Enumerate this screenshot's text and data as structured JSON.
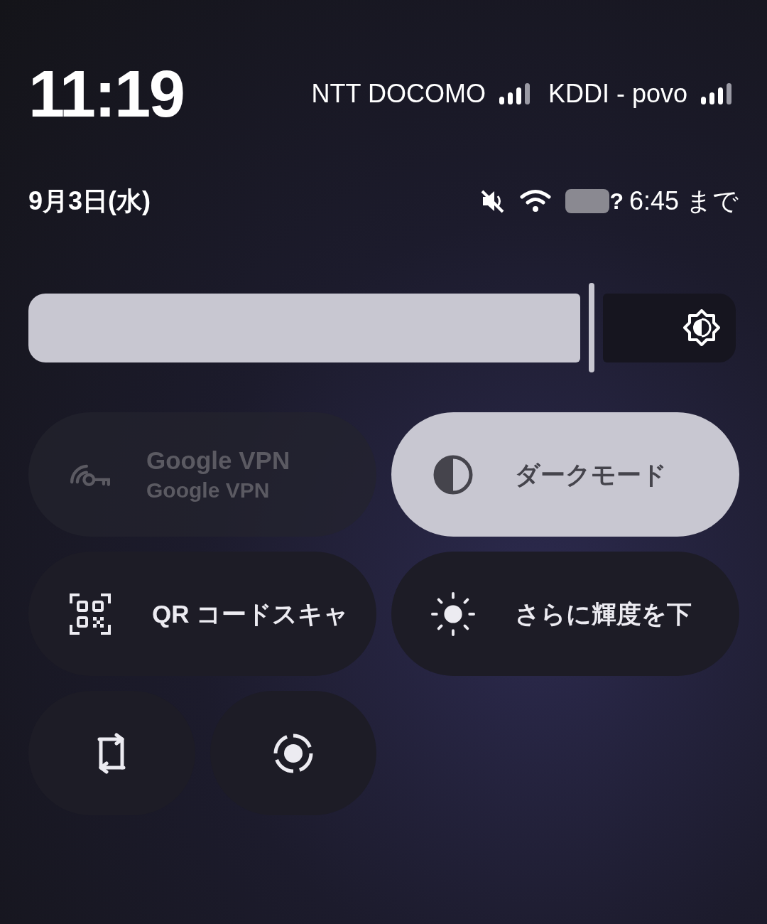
{
  "status_bar": {
    "time": "11:19",
    "carriers": [
      {
        "name": "NTT DOCOMO"
      },
      {
        "name": "KDDI - povo"
      }
    ],
    "date": "9月3日(水)",
    "alarm_mark": "?",
    "alarm_time": "6:45 まで"
  },
  "brightness": {
    "level": 0.78
  },
  "tiles": [
    {
      "kind": "wide",
      "on": false,
      "disabled": true,
      "label": "Google VPN",
      "sublabel": "Google VPN"
    },
    {
      "kind": "wide",
      "on": true,
      "disabled": false,
      "label": "ダークモード"
    },
    {
      "kind": "wide",
      "on": false,
      "disabled": false,
      "label": "QR コードスキャ"
    },
    {
      "kind": "wide",
      "on": false,
      "disabled": false,
      "label": "さらに輝度を下"
    },
    {
      "kind": "small",
      "on": false,
      "disabled": false
    },
    {
      "kind": "small",
      "on": false,
      "disabled": false
    }
  ]
}
